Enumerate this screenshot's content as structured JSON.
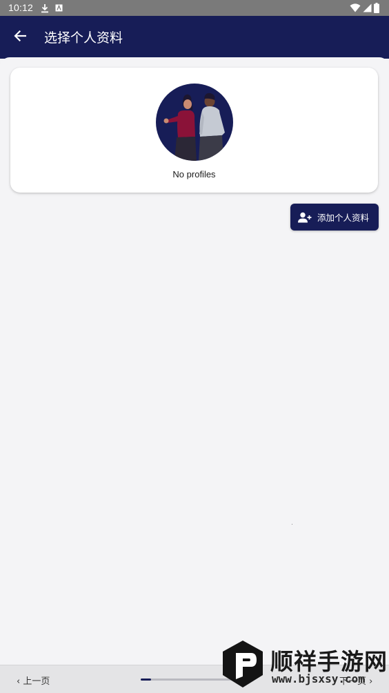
{
  "status_bar": {
    "time": "10:12",
    "icons": [
      "download-icon",
      "notification-a-icon",
      "wifi-icon",
      "signal-icon",
      "battery-icon"
    ]
  },
  "app_bar": {
    "title": "选择个人资料",
    "back_icon": "arrow-back-icon"
  },
  "profiles_card": {
    "illustration": "two-people-illustration",
    "empty_text": "No profiles"
  },
  "add_button": {
    "label": "添加个人资料",
    "icon": "person-add-icon"
  },
  "bottom_bar": {
    "prev_label": "‹ 上一页",
    "next_label": "下一页 ›",
    "progress": 0.1
  },
  "watermark": {
    "title": "顺祥手游网",
    "url": "www.bjsxsy.com"
  },
  "colors": {
    "primary": "#171d57",
    "background": "#f4f4f6",
    "card": "#ffffff"
  }
}
